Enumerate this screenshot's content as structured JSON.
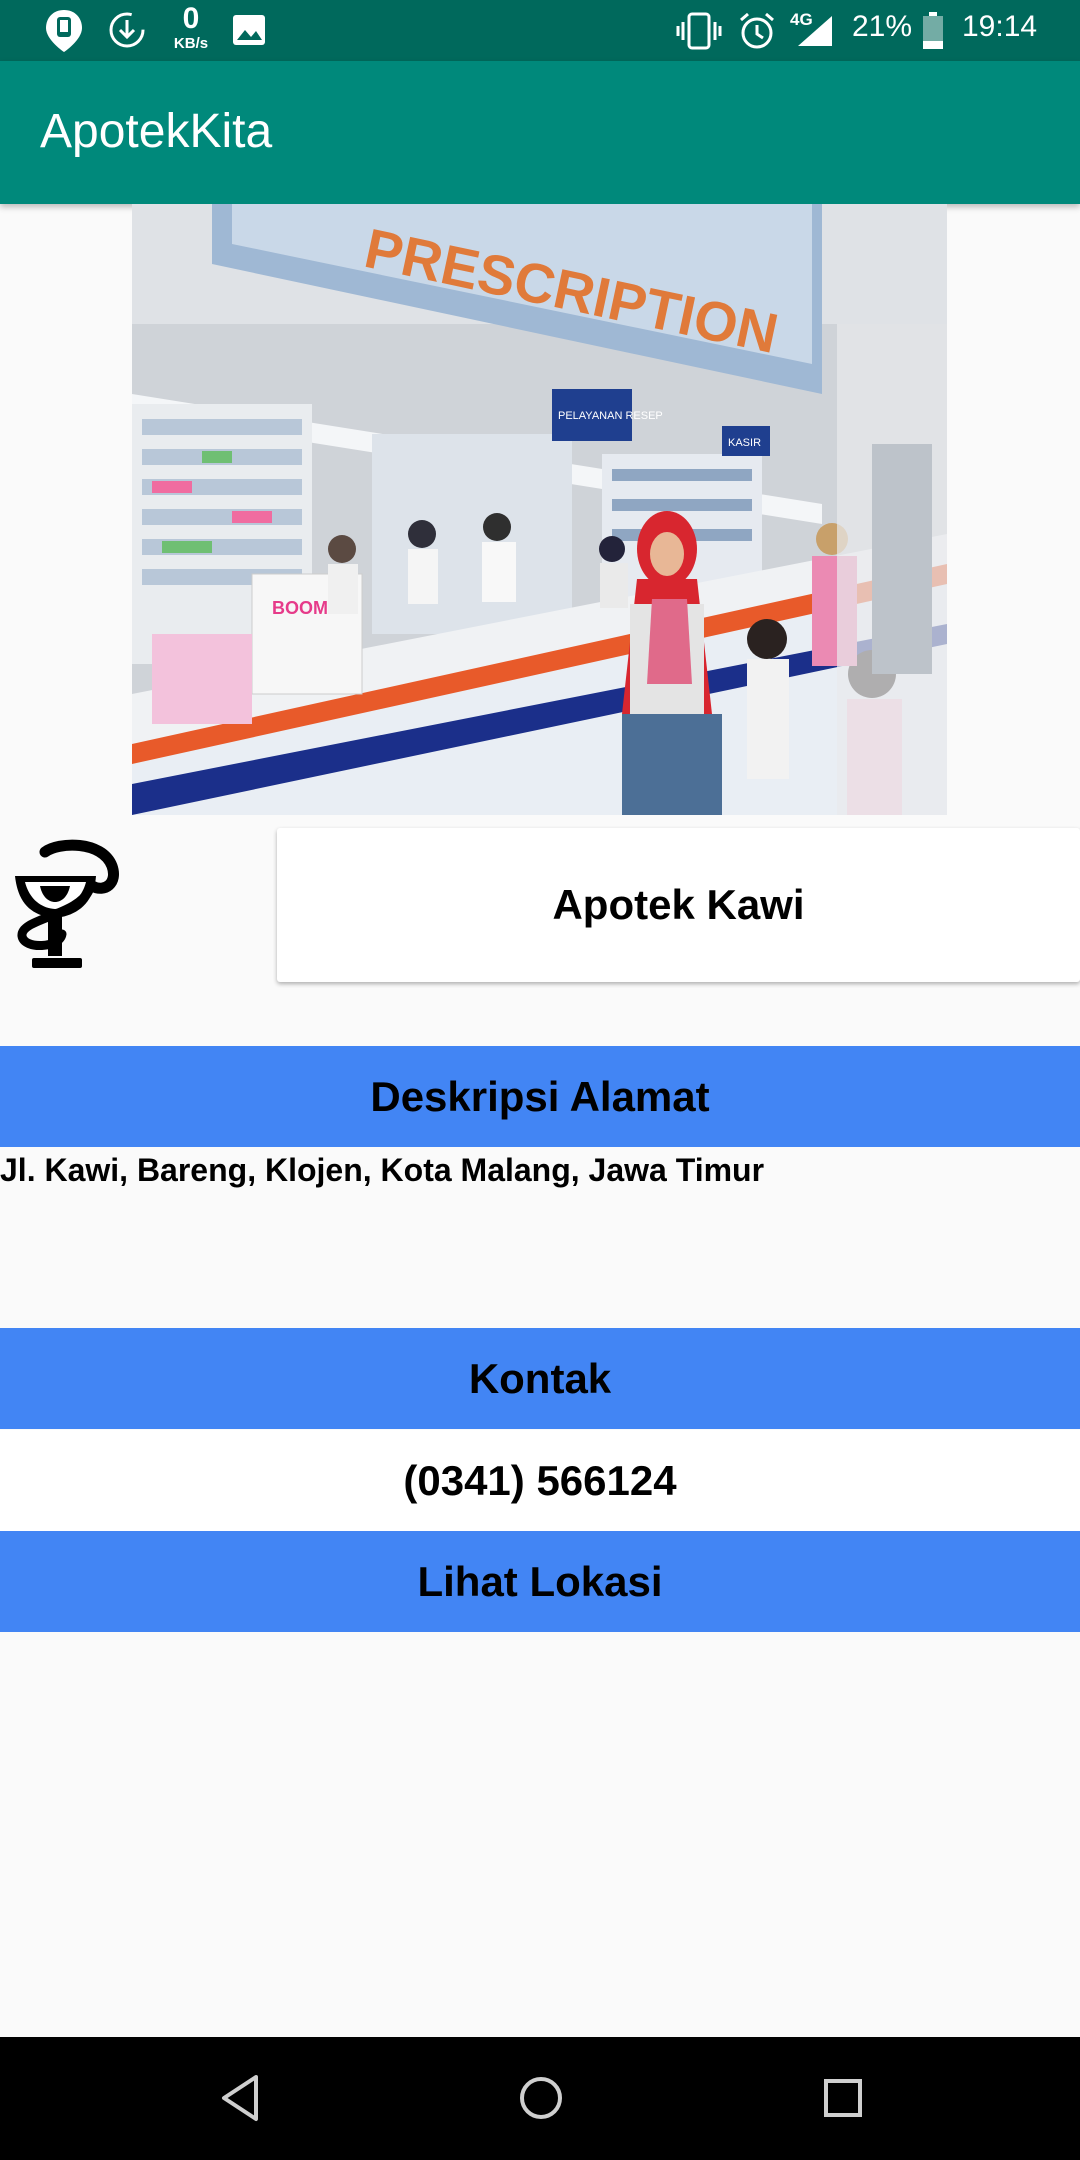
{
  "status_bar": {
    "speed_value": "0",
    "speed_unit": "KB/s",
    "network_label": "4G",
    "battery_percent": "21%",
    "time": "19:14",
    "icons": [
      "location-icon",
      "download-icon",
      "image-icon",
      "vibrate-icon",
      "alarm-icon",
      "signal-icon",
      "battery-icon"
    ]
  },
  "app_bar": {
    "title": "ApotekKita"
  },
  "pharmacy": {
    "name": "Apotek Kawi",
    "logo_icon": "pharmacy-bowl-of-hygieia-icon",
    "photo_text": {
      "banner": "PRESCRIPTION",
      "sign_service": "PELAYANAN RESEP",
      "sign_cashier": "KASIR",
      "box": "BOOM"
    }
  },
  "sections": {
    "address_header": "Deskripsi Alamat",
    "address_text": "Jl. Kawi, Bareng, Klojen, Kota Malang, Jawa Timur",
    "contact_header": "Kontak",
    "contact_phone": "(0341) 566124",
    "location_button": "Lihat Lokasi"
  },
  "colors": {
    "status_bar": "#00695c",
    "app_bar": "#00897b",
    "section_band": "#4285f4",
    "background": "#fafafa"
  },
  "nav_bar": {
    "icons": [
      "back-icon",
      "home-icon",
      "recents-icon"
    ]
  }
}
